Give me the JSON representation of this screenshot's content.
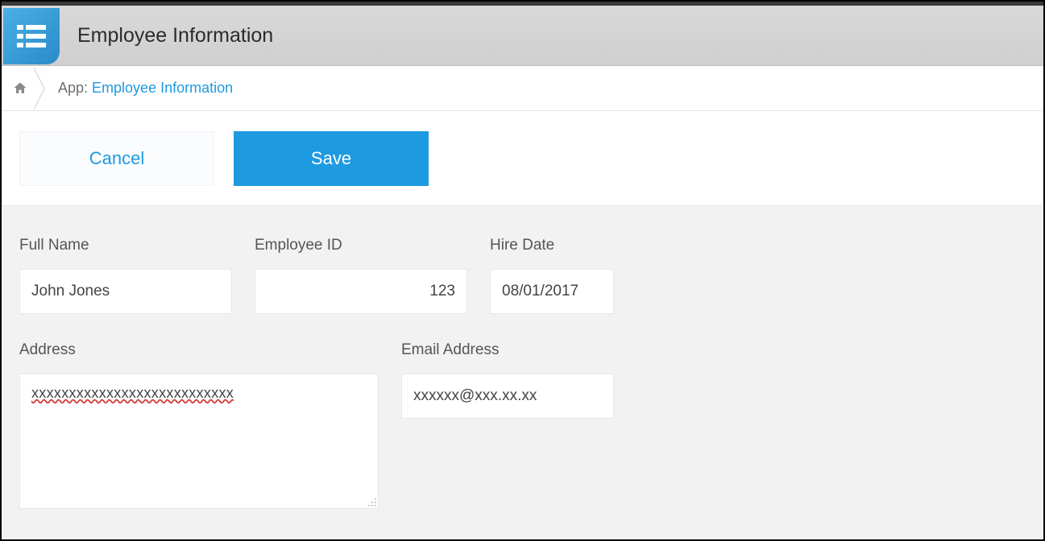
{
  "header": {
    "title": "Employee Information"
  },
  "breadcrumb": {
    "prefix": "App: ",
    "link_text": "Employee Information"
  },
  "actions": {
    "cancel_label": "Cancel",
    "save_label": "Save"
  },
  "form": {
    "full_name": {
      "label": "Full Name",
      "value": "John Jones"
    },
    "employee_id": {
      "label": "Employee ID",
      "value": "123"
    },
    "hire_date": {
      "label": "Hire Date",
      "value": "08/01/2017"
    },
    "address": {
      "label": "Address",
      "value": "xxxxxxxxxxxxxxxxxxxxxxxxxxx"
    },
    "email": {
      "label": "Email Address",
      "value": "xxxxxx@xxx.xx.xx"
    }
  }
}
